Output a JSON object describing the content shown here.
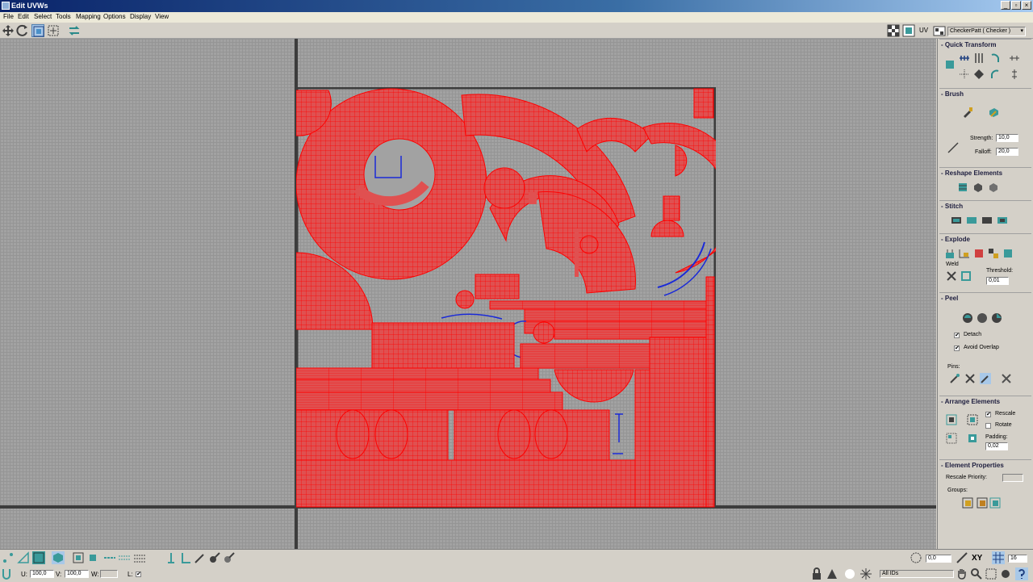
{
  "window": {
    "title": "Edit UVWs",
    "minimize": "_",
    "restore": "▫",
    "close": "×"
  },
  "menu": [
    "File",
    "Edit",
    "Select",
    "Tools",
    "Mapping",
    "Options",
    "Display",
    "View"
  ],
  "toolbar": {
    "uv_label": "UV",
    "map_select": "CheckerPatt ( Checker )",
    "map_arrow": "▾",
    "tools": [
      "move-icon",
      "rotate-icon",
      "scale-icon",
      "freeform-icon",
      "mirror-icon"
    ]
  },
  "colors": {
    "uv_fill": "#e05050",
    "uv_wire": "#ff0000",
    "selected_wire": "#1a2ad8",
    "viewport_bg": "#a2a2a2"
  },
  "panel": {
    "quick_transform": {
      "title": "Quick Transform"
    },
    "brush": {
      "title": "Brush",
      "strength_label": "Strength:",
      "strength_value": "10,0",
      "falloff_label": "Falloff:",
      "falloff_value": "20,0"
    },
    "reshape": {
      "title": "Reshape Elements"
    },
    "stitch": {
      "title": "Stitch"
    },
    "explode": {
      "title": "Explode",
      "weld_label": "Weld",
      "threshold_label": "Threshold:",
      "threshold_value": "0,01"
    },
    "peel": {
      "title": "Peel",
      "detach_label": "Detach",
      "detach_checked": "✔",
      "avoid_overlap_label": "Avoid Overlap",
      "avoid_overlap_checked": "✔",
      "pins_label": "Pins:"
    },
    "arrange": {
      "title": "Arrange Elements",
      "rescale_label": "Rescale",
      "rescale_checked": "✔",
      "rotate_label": "Rotate",
      "padding_label": "Padding:",
      "padding_value": "0,02"
    },
    "element_props": {
      "title": "Element Properties",
      "rescale_priority_label": "Rescale Priority:",
      "groups_label": "Groups:"
    }
  },
  "status": {
    "u_label": "U:",
    "u_value": "100,0",
    "v_label": "V:",
    "v_value": "100,0",
    "w_label": "W:",
    "w_value": "",
    "l_label": "L:",
    "l_checked": "✔",
    "angle_value": "0,0",
    "axis_label": "XY",
    "grid_value": "16",
    "ids_select": "All IDs"
  }
}
